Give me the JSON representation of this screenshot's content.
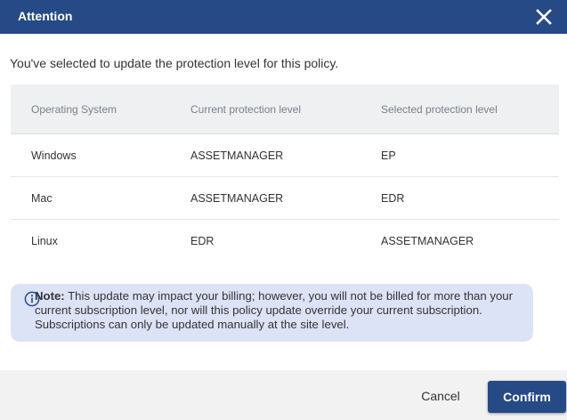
{
  "dialog": {
    "title": "Attention",
    "close_icon": "close-icon"
  },
  "intro_text": "You've selected to update the protection level for this policy.",
  "table": {
    "headers": [
      "Operating System",
      "Current protection level",
      "Selected protection level"
    ],
    "rows": [
      {
        "os": "Windows",
        "current": "ASSETMANAGER",
        "selected": "EP"
      },
      {
        "os": "Mac",
        "current": "ASSETMANAGER",
        "selected": "EDR"
      },
      {
        "os": "Linux",
        "current": "EDR",
        "selected": "ASSETMANAGER"
      }
    ]
  },
  "note": {
    "icon": "info-icon",
    "label": "Note:",
    "text": " This update may impact your billing; however, you will not be billed for more than your current subscription level, nor will this policy update override your current subscription. Subscriptions can only be updated manually at the site level."
  },
  "footer": {
    "cancel_label": "Cancel",
    "confirm_label": "Confirm"
  },
  "colors": {
    "header_bg": "#254a86",
    "note_bg": "#dde3f6",
    "confirm_bg": "#254a86"
  }
}
